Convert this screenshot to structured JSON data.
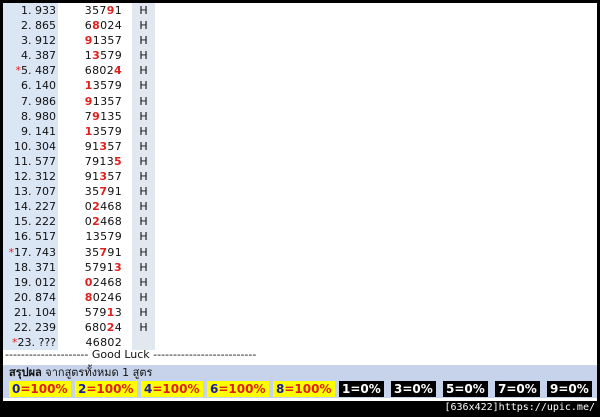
{
  "rows": [
    {
      "no": "1.",
      "left": "933",
      "num": [
        "3",
        "5",
        "7",
        "9",
        "1"
      ],
      "hi": [
        3
      ],
      "flag": "H",
      "star": false
    },
    {
      "no": "2.",
      "left": "865",
      "num": [
        "6",
        "8",
        "0",
        "2",
        "4"
      ],
      "hi": [
        1
      ],
      "flag": "H",
      "star": false
    },
    {
      "no": "3.",
      "left": "912",
      "num": [
        "9",
        "1",
        "3",
        "5",
        "7"
      ],
      "hi": [
        0
      ],
      "flag": "H",
      "star": false
    },
    {
      "no": "4.",
      "left": "387",
      "num": [
        "1",
        "3",
        "5",
        "7",
        "9"
      ],
      "hi": [
        1
      ],
      "flag": "H",
      "star": false
    },
    {
      "no": "5.",
      "left": "487",
      "num": [
        "6",
        "8",
        "0",
        "2",
        "4"
      ],
      "hi": [
        4
      ],
      "flag": "H",
      "star": true
    },
    {
      "no": "6.",
      "left": "140",
      "num": [
        "1",
        "3",
        "5",
        "7",
        "9"
      ],
      "hi": [
        0
      ],
      "flag": "H",
      "star": false
    },
    {
      "no": "7.",
      "left": "986",
      "num": [
        "9",
        "1",
        "3",
        "5",
        "7"
      ],
      "hi": [
        0
      ],
      "flag": "H",
      "star": false
    },
    {
      "no": "8.",
      "left": "980",
      "num": [
        "7",
        "9",
        "1",
        "3",
        "5"
      ],
      "hi": [
        1
      ],
      "flag": "H",
      "star": false
    },
    {
      "no": "9.",
      "left": "141",
      "num": [
        "1",
        "3",
        "5",
        "7",
        "9"
      ],
      "hi": [
        0
      ],
      "flag": "H",
      "star": false
    },
    {
      "no": "10.",
      "left": "304",
      "num": [
        "9",
        "1",
        "3",
        "5",
        "7"
      ],
      "hi": [
        2
      ],
      "flag": "H",
      "star": false
    },
    {
      "no": "11.",
      "left": "577",
      "num": [
        "7",
        "9",
        "1",
        "3",
        "5"
      ],
      "hi": [
        4
      ],
      "flag": "H",
      "star": false
    },
    {
      "no": "12.",
      "left": "312",
      "num": [
        "9",
        "1",
        "3",
        "5",
        "7"
      ],
      "hi": [
        2
      ],
      "flag": "H",
      "star": false
    },
    {
      "no": "13.",
      "left": "707",
      "num": [
        "3",
        "5",
        "7",
        "9",
        "1"
      ],
      "hi": [
        2
      ],
      "flag": "H",
      "star": false
    },
    {
      "no": "14.",
      "left": "227",
      "num": [
        "0",
        "2",
        "4",
        "6",
        "8"
      ],
      "hi": [
        1
      ],
      "flag": "H",
      "star": false
    },
    {
      "no": "15.",
      "left": "222",
      "num": [
        "0",
        "2",
        "4",
        "6",
        "8"
      ],
      "hi": [
        1
      ],
      "flag": "H",
      "star": false
    },
    {
      "no": "16.",
      "left": "517",
      "num": [
        "1",
        "3",
        "5",
        "7",
        "9"
      ],
      "hi": [],
      "flag": "H",
      "star": false
    },
    {
      "no": "17.",
      "left": "743",
      "num": [
        "3",
        "5",
        "7",
        "9",
        "1"
      ],
      "hi": [
        2
      ],
      "flag": "H",
      "star": true
    },
    {
      "no": "18.",
      "left": "371",
      "num": [
        "5",
        "7",
        "9",
        "1",
        "3"
      ],
      "hi": [
        4
      ],
      "flag": "H",
      "star": false
    },
    {
      "no": "19.",
      "left": "012",
      "num": [
        "0",
        "2",
        "4",
        "6",
        "8"
      ],
      "hi": [
        0
      ],
      "flag": "H",
      "star": false
    },
    {
      "no": "20.",
      "left": "874",
      "num": [
        "8",
        "0",
        "2",
        "4",
        "6"
      ],
      "hi": [
        0
      ],
      "flag": "H",
      "star": false
    },
    {
      "no": "21.",
      "left": "104",
      "num": [
        "5",
        "7",
        "9",
        "1",
        "3"
      ],
      "hi": [
        3
      ],
      "flag": "H",
      "star": false
    },
    {
      "no": "22.",
      "left": "239",
      "num": [
        "6",
        "8",
        "0",
        "2",
        "4"
      ],
      "hi": [
        3
      ],
      "flag": "H",
      "star": false
    },
    {
      "no": "23.",
      "left": "???",
      "num": [
        "4",
        "6",
        "8",
        "0",
        "2"
      ],
      "hi": [],
      "flag": "",
      "star": true
    }
  ],
  "star_glyph": "*",
  "good_luck": "--------------------- Good Luck --------------------------",
  "summary": {
    "label": "สรุปผล",
    "text": " จากสูตรทั้งหมด 1 สูตร"
  },
  "badges": [
    {
      "digit": "0",
      "pct": "=100%",
      "hit": true
    },
    {
      "digit": "2",
      "pct": "=100%",
      "hit": true
    },
    {
      "digit": "4",
      "pct": "=100%",
      "hit": true
    },
    {
      "digit": "6",
      "pct": "=100%",
      "hit": true
    },
    {
      "digit": "8",
      "pct": "=100%",
      "hit": true
    },
    {
      "digit": "1",
      "pct": "=0%",
      "hit": false
    },
    {
      "digit": "3",
      "pct": "=0%",
      "hit": false
    },
    {
      "digit": "5",
      "pct": "=0%",
      "hit": false
    },
    {
      "digit": "7",
      "pct": "=0%",
      "hit": false
    },
    {
      "digit": "9",
      "pct": "=0%",
      "hit": false
    }
  ],
  "credit": "[636x422]https://upic.me/",
  "colors": {
    "highlight": "#e0201c",
    "hit_bg": "#ffff00",
    "miss_bg": "#000000"
  }
}
